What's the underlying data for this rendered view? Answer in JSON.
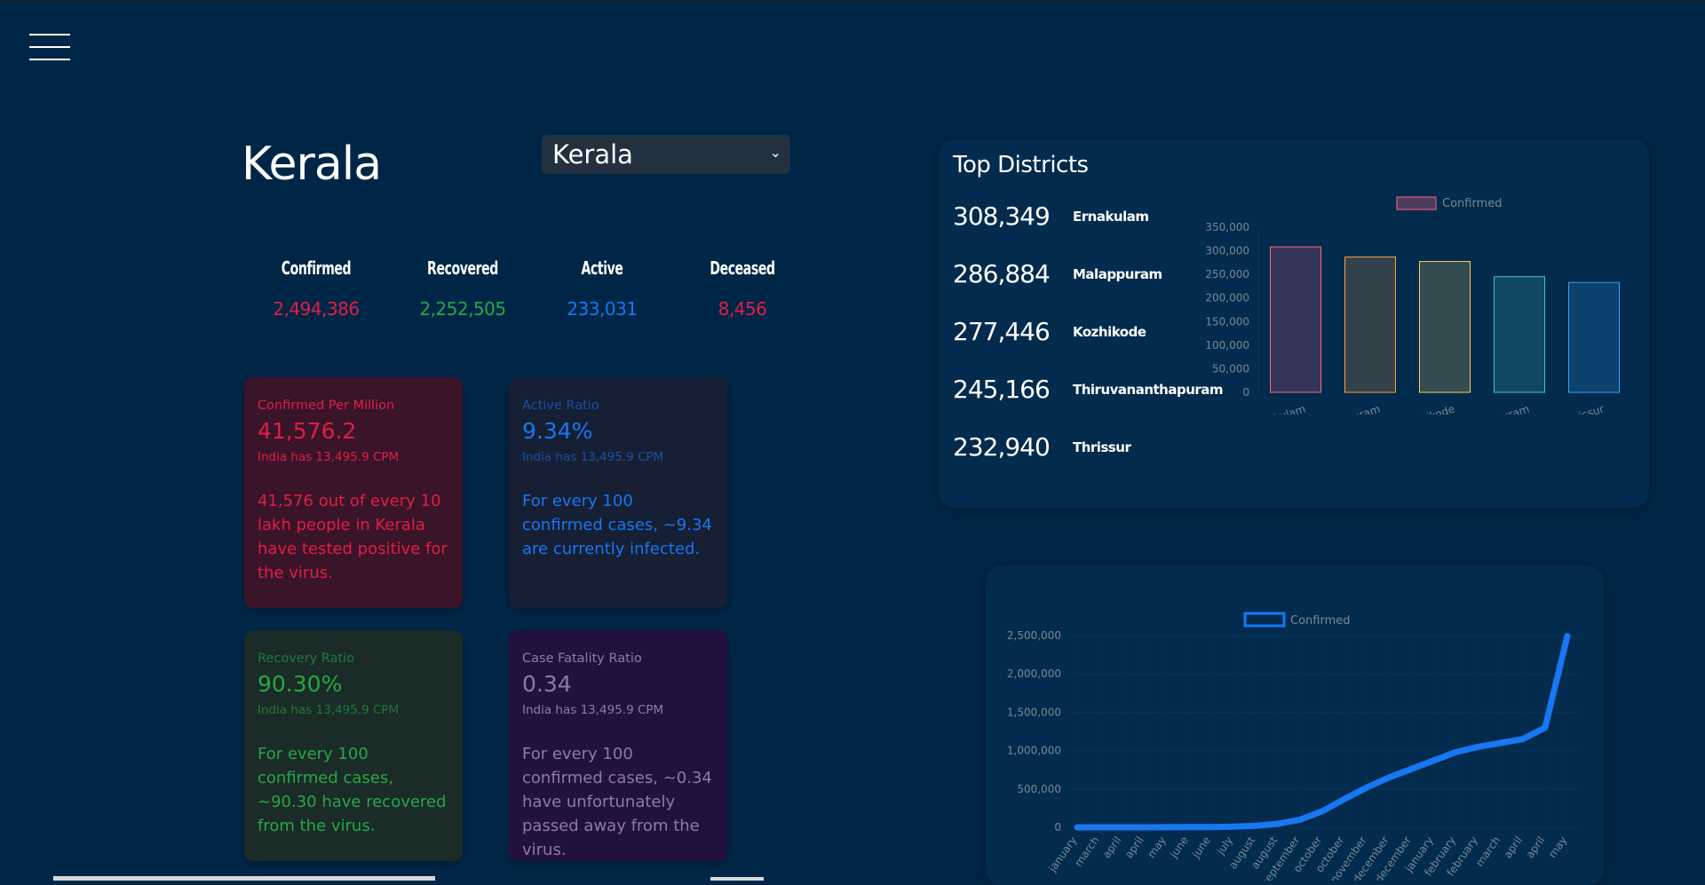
{
  "menu": {
    "icon": "hamburger-menu-icon"
  },
  "state": {
    "title": "Kerala",
    "selected": "Kerala"
  },
  "stats": {
    "confirmed": {
      "label": "Confirmed",
      "value": "2,494,386",
      "color": "#e11d48"
    },
    "recovered": {
      "label": "Recovered",
      "value": "2,252,505",
      "color": "#28a745"
    },
    "active": {
      "label": "Active",
      "value": "233,031",
      "color": "#1877f2"
    },
    "deceased": {
      "label": "Deceased",
      "value": "8,456",
      "color": "#e11d48"
    }
  },
  "cards": {
    "cpm": {
      "title": "Confirmed Per Million",
      "value": "41,576.2",
      "sub": "India has 13,495.9 CPM",
      "desc": "41,576 out of every 10 lakh people in Kerala have tested positive for the virus.",
      "color": "#e11d48",
      "bg": "#3a1428"
    },
    "active_ratio": {
      "title": "Active Ratio",
      "value": "9.34%",
      "sub": "India has 13,495.9 CPM",
      "desc": "For every 100 confirmed cases, ~9.34 are currently infected.",
      "color": "#1877f2",
      "bg": "#161f33"
    },
    "recovery_ratio": {
      "title": "Recovery Ratio",
      "value": "90.30%",
      "sub": "India has 13,495.9 CPM",
      "desc": "For every 100 confirmed cases, ~90.30 have recovered from the virus.",
      "color": "#28a745",
      "bg": "#1a2b28"
    },
    "cfr": {
      "title": "Case Fatality Ratio",
      "value": "0.34",
      "sub": "India has 13,495.9 CPM",
      "desc": "For every 100 confirmed cases, ~0.34 have unfortunately passed away from the virus.",
      "color": "#8e7aa6",
      "bg": "#22103f"
    }
  },
  "top_districts": {
    "title": "Top Districts",
    "rows": [
      {
        "value": "308,349",
        "name": "Ernakulam"
      },
      {
        "value": "286,884",
        "name": "Malappuram"
      },
      {
        "value": "277,446",
        "name": "Kozhikode"
      },
      {
        "value": "245,166",
        "name": "Thiruvananthapuram"
      },
      {
        "value": "232,940",
        "name": "Thrissur"
      }
    ]
  },
  "chart_data": [
    {
      "type": "bar",
      "categories": [
        "Ernakulam",
        "Malappuram",
        "Kozhikode",
        "Thiruvananthapuram",
        "Thrissur"
      ],
      "series": [
        {
          "name": "Confirmed",
          "values": [
            308349,
            286884,
            277446,
            245166,
            232940
          ]
        }
      ],
      "bar_colors": [
        "#ff6384",
        "#ff9f40",
        "#ffcd56",
        "#4bc0c0",
        "#36a2eb"
      ],
      "yticks": [
        "350,000",
        "300,000",
        "250,000",
        "200,000",
        "150,000",
        "100,000",
        "50,000",
        "0"
      ],
      "ylim": [
        0,
        350000
      ],
      "legend": "top"
    },
    {
      "type": "line",
      "x": [
        "january",
        "march",
        "april",
        "april",
        "may",
        "june",
        "june",
        "july",
        "august",
        "august",
        "september",
        "october",
        "october",
        "november",
        "december",
        "december",
        "january",
        "february",
        "february",
        "march",
        "april",
        "april",
        "may"
      ],
      "series": [
        {
          "name": "Confirmed",
          "values": [
            0,
            0,
            300,
            500,
            800,
            2000,
            4000,
            8000,
            20000,
            45000,
            100000,
            210000,
            370000,
            520000,
            650000,
            760000,
            870000,
            980000,
            1050000,
            1100000,
            1150000,
            1300000,
            2494386
          ]
        }
      ],
      "yticks": [
        "2,500,000",
        "2,000,000",
        "1,500,000",
        "1,000,000",
        "500,000",
        "0"
      ],
      "ylim": [
        0,
        2500000
      ],
      "color": "#1877f2",
      "legend": "top"
    }
  ]
}
